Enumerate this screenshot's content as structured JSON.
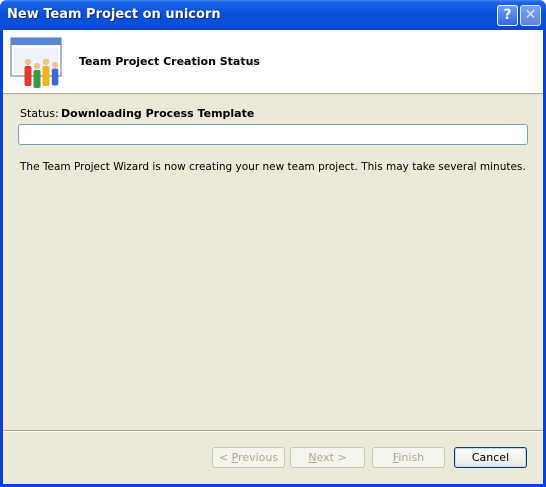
{
  "window": {
    "title": "New Team Project on unicorn",
    "help_glyph": "?",
    "close_glyph": "✕"
  },
  "header": {
    "title": "Team Project Creation Status",
    "icon": "team-project-icon"
  },
  "status": {
    "label": "Status:",
    "value": "Downloading Process Template",
    "progress_fraction": 0
  },
  "message": "The Team Project Wizard is now creating your new team project.  This may take several minutes.",
  "buttons": {
    "previous": {
      "prefix": "< ",
      "mnemonic": "P",
      "rest": "revious"
    },
    "next": {
      "mnemonic": "N",
      "rest": "ext >"
    },
    "finish": {
      "mnemonic": "F",
      "rest": "inish"
    },
    "cancel": "Cancel"
  },
  "colors": {
    "titlebar": "#0a50d8",
    "dialog_background": "#ece9d8",
    "progress_border": "#7f9db9",
    "disabled_text": "#aca899"
  }
}
